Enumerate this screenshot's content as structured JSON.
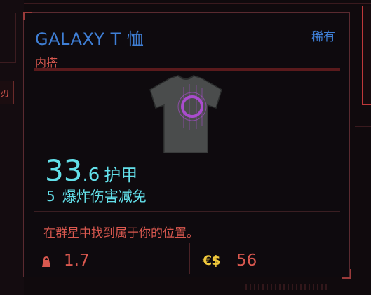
{
  "background": {
    "left_box_text": "刃"
  },
  "item": {
    "name": "GALAXY T 恤",
    "rarity": "稀有",
    "category": "内搭",
    "armor": {
      "integer": "33",
      "decimal": ".6",
      "label": "护甲"
    },
    "explosion_reduction": {
      "value": "5",
      "label": "爆炸伤害减免"
    },
    "description": "在群星中找到属于你的位置。",
    "weight": "1.7",
    "price": "56",
    "price_icon": "eddies-icon"
  },
  "colors": {
    "title_blue": "#3f7fd6",
    "stat_cyan": "#63e0ea",
    "text_red": "#d9584f",
    "currency_yellow": "#f1c93c",
    "panel_bg": "#0e0a0e"
  }
}
